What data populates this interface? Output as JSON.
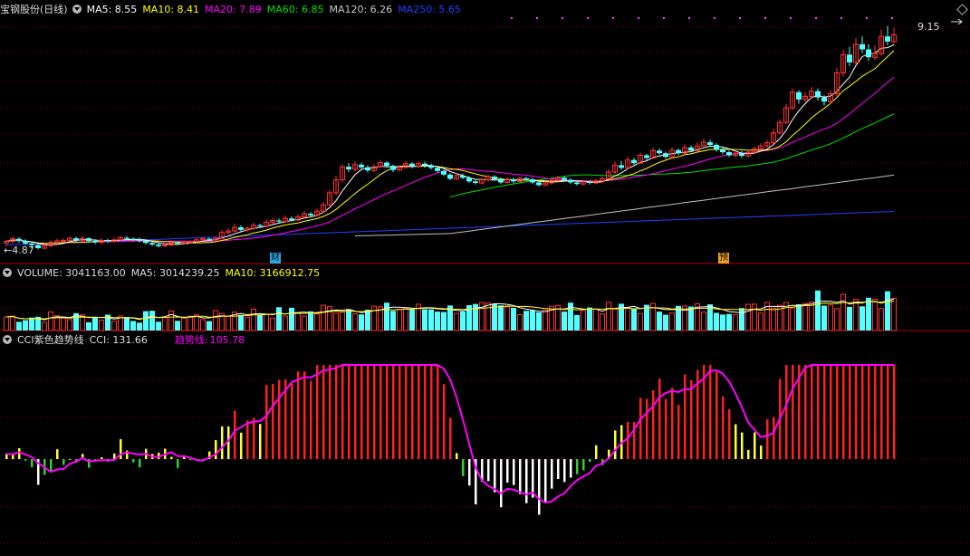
{
  "price_header": {
    "title": "宝钢股份(日线)",
    "ma5": "MA5: 8.55",
    "ma10": "MA10: 8.41",
    "ma20": "MA20: 7.89",
    "ma60": "MA60: 6.85",
    "ma120": "MA120: 6.26",
    "ma250": "MA250: 5.65"
  },
  "price_labels": {
    "high": "9.15",
    "low": "4.87"
  },
  "event_tags": [
    "财",
    "预"
  ],
  "volume_header": {
    "title": "VOLUME: 3041163.00",
    "ma5": "MA5: 3014239.25",
    "ma10": "MA10: 3166912.75"
  },
  "cci_header": {
    "title": "CCI紫色趋势线",
    "cci": "CCI: 131.66",
    "trend_label": "趋势线:",
    "trend_value": "105.78"
  },
  "colors": {
    "up": "#ff3232",
    "down": "#54ffff",
    "ma5": "#ffffff",
    "ma10": "#ffff00",
    "ma20": "#ff00ff",
    "ma60": "#00e000",
    "ma120": "#c0c0c0",
    "ma250": "#2040ff",
    "cci_trend": "#ff00ff",
    "grid": "#7a0000"
  },
  "chart_data": {
    "type": "candlestick",
    "candles": [
      [
        4.99,
        5.02,
        5.05,
        4.92
      ],
      [
        5.02,
        5.07,
        5.12,
        4.98
      ],
      [
        5.07,
        5.03,
        5.1,
        4.99
      ],
      [
        5.03,
        4.98,
        5.06,
        4.95
      ],
      [
        4.98,
        4.95,
        5.01,
        4.89
      ],
      [
        4.95,
        4.89,
        4.97,
        4.87
      ],
      [
        4.89,
        4.94,
        4.98,
        4.87
      ],
      [
        4.94,
        5.0,
        5.04,
        4.91
      ],
      [
        5.0,
        5.03,
        5.07,
        4.97
      ],
      [
        5.03,
        5.04,
        5.08,
        5.0
      ],
      [
        5.04,
        5.08,
        5.12,
        5.01
      ],
      [
        5.08,
        5.04,
        5.11,
        5.01
      ],
      [
        5.04,
        5.08,
        5.12,
        5.01
      ],
      [
        5.08,
        5.03,
        5.1,
        5.0
      ],
      [
        5.03,
        5.0,
        5.06,
        4.97
      ],
      [
        5.0,
        5.04,
        5.08,
        4.98
      ],
      [
        5.04,
        5.02,
        5.07,
        4.99
      ],
      [
        5.02,
        5.05,
        5.09,
        5.0
      ],
      [
        5.05,
        5.09,
        5.13,
        5.03
      ],
      [
        5.09,
        5.07,
        5.12,
        5.04
      ],
      [
        5.07,
        5.06,
        5.1,
        5.03
      ],
      [
        5.06,
        5.03,
        5.09,
        5.0
      ],
      [
        5.03,
        4.99,
        5.05,
        4.96
      ],
      [
        4.99,
        4.96,
        5.02,
        4.93
      ],
      [
        4.96,
        4.93,
        4.99,
        4.9
      ],
      [
        4.93,
        4.95,
        4.98,
        4.91
      ],
      [
        4.95,
        4.99,
        5.02,
        4.93
      ],
      [
        4.99,
        4.98,
        5.02,
        4.95
      ],
      [
        4.98,
        5.0,
        5.04,
        4.96
      ],
      [
        5.0,
        5.02,
        5.05,
        4.98
      ],
      [
        5.02,
        5.05,
        5.08,
        5.0
      ],
      [
        5.05,
        5.07,
        5.1,
        5.03
      ],
      [
        5.07,
        5.05,
        5.09,
        5.03
      ],
      [
        5.05,
        5.08,
        5.11,
        5.03
      ],
      [
        5.08,
        5.19,
        5.24,
        5.06
      ],
      [
        5.19,
        5.22,
        5.28,
        5.15
      ],
      [
        5.22,
        5.29,
        5.36,
        5.19
      ],
      [
        5.29,
        5.24,
        5.33,
        5.21
      ],
      [
        5.24,
        5.27,
        5.31,
        5.2
      ],
      [
        5.27,
        5.33,
        5.38,
        5.24
      ],
      [
        5.33,
        5.31,
        5.36,
        5.28
      ],
      [
        5.31,
        5.39,
        5.44,
        5.29
      ],
      [
        5.39,
        5.42,
        5.47,
        5.36
      ],
      [
        5.42,
        5.4,
        5.46,
        5.37
      ],
      [
        5.4,
        5.46,
        5.52,
        5.38
      ],
      [
        5.46,
        5.43,
        5.5,
        5.4
      ],
      [
        5.43,
        5.49,
        5.54,
        5.41
      ],
      [
        5.49,
        5.55,
        5.6,
        5.46
      ],
      [
        5.55,
        5.52,
        5.58,
        5.48
      ],
      [
        5.52,
        5.6,
        5.65,
        5.5
      ],
      [
        5.6,
        5.72,
        5.78,
        5.57
      ],
      [
        5.72,
        5.95,
        6.0,
        5.7
      ],
      [
        5.95,
        6.2,
        6.28,
        5.9
      ],
      [
        6.2,
        6.45,
        6.5,
        6.15
      ],
      [
        6.45,
        6.4,
        6.52,
        6.35
      ],
      [
        6.4,
        6.49,
        6.55,
        6.36
      ],
      [
        6.49,
        6.44,
        6.53,
        6.4
      ],
      [
        6.44,
        6.38,
        6.48,
        6.34
      ],
      [
        6.38,
        6.45,
        6.5,
        6.35
      ],
      [
        6.45,
        6.53,
        6.58,
        6.42
      ],
      [
        6.53,
        6.47,
        6.56,
        6.43
      ],
      [
        6.47,
        6.39,
        6.49,
        6.35
      ],
      [
        6.39,
        6.44,
        6.48,
        6.36
      ],
      [
        6.44,
        6.51,
        6.56,
        6.41
      ],
      [
        6.51,
        6.46,
        6.54,
        6.42
      ],
      [
        6.46,
        6.51,
        6.55,
        6.43
      ],
      [
        6.51,
        6.48,
        6.55,
        6.43
      ],
      [
        6.48,
        6.43,
        6.51,
        6.4
      ],
      [
        6.43,
        6.37,
        6.46,
        6.34
      ],
      [
        6.37,
        6.3,
        6.4,
        6.27
      ],
      [
        6.3,
        6.22,
        6.33,
        6.19
      ],
      [
        6.22,
        6.28,
        6.33,
        6.2
      ],
      [
        6.28,
        6.24,
        6.32,
        6.21
      ],
      [
        6.24,
        6.17,
        6.27,
        6.14
      ],
      [
        6.17,
        6.14,
        6.2,
        6.11
      ],
      [
        6.14,
        6.2,
        6.24,
        6.11
      ],
      [
        6.2,
        6.26,
        6.3,
        6.16
      ],
      [
        6.26,
        6.21,
        6.29,
        6.18
      ],
      [
        6.21,
        6.15,
        6.24,
        6.12
      ],
      [
        6.15,
        6.21,
        6.25,
        6.13
      ],
      [
        6.21,
        6.17,
        6.24,
        6.13
      ],
      [
        6.17,
        6.23,
        6.27,
        6.15
      ],
      [
        6.23,
        6.21,
        6.26,
        6.18
      ],
      [
        6.21,
        6.15,
        6.24,
        6.12
      ],
      [
        6.15,
        6.1,
        6.17,
        6.07
      ],
      [
        6.1,
        6.14,
        6.18,
        6.08
      ],
      [
        6.14,
        6.19,
        6.23,
        6.11
      ],
      [
        6.19,
        6.24,
        6.28,
        6.17
      ],
      [
        6.24,
        6.2,
        6.27,
        6.16
      ],
      [
        6.2,
        6.15,
        6.23,
        6.12
      ],
      [
        6.15,
        6.12,
        6.18,
        6.09
      ],
      [
        6.12,
        6.16,
        6.2,
        6.1
      ],
      [
        6.16,
        6.14,
        6.19,
        6.11
      ],
      [
        6.14,
        6.18,
        6.22,
        6.12
      ],
      [
        6.18,
        6.22,
        6.26,
        6.15
      ],
      [
        6.22,
        6.35,
        6.41,
        6.2
      ],
      [
        6.35,
        6.48,
        6.55,
        6.31
      ],
      [
        6.48,
        6.43,
        6.56,
        6.39
      ],
      [
        6.43,
        6.58,
        6.65,
        6.4
      ],
      [
        6.58,
        6.52,
        6.62,
        6.49
      ],
      [
        6.52,
        6.67,
        6.72,
        6.5
      ],
      [
        6.67,
        6.62,
        6.7,
        6.58
      ],
      [
        6.62,
        6.76,
        6.82,
        6.59
      ],
      [
        6.76,
        6.71,
        6.8,
        6.68
      ],
      [
        6.71,
        6.64,
        6.74,
        6.6
      ],
      [
        6.64,
        6.77,
        6.82,
        6.61
      ],
      [
        6.77,
        6.71,
        6.8,
        6.67
      ],
      [
        6.71,
        6.82,
        6.88,
        6.68
      ],
      [
        6.82,
        6.76,
        6.86,
        6.73
      ],
      [
        6.76,
        6.85,
        6.92,
        6.73
      ],
      [
        6.85,
        6.92,
        6.99,
        6.82
      ],
      [
        6.92,
        6.87,
        6.97,
        6.83
      ],
      [
        6.87,
        6.78,
        6.9,
        6.74
      ],
      [
        6.78,
        6.73,
        6.82,
        6.69
      ],
      [
        6.73,
        6.67,
        6.76,
        6.64
      ],
      [
        6.67,
        6.71,
        6.75,
        6.63
      ],
      [
        6.71,
        6.66,
        6.76,
        6.62
      ],
      [
        6.66,
        6.73,
        6.77,
        6.63
      ],
      [
        6.73,
        6.79,
        6.84,
        6.7
      ],
      [
        6.79,
        6.85,
        6.9,
        6.76
      ],
      [
        6.85,
        6.91,
        6.96,
        6.82
      ],
      [
        6.91,
        7.1,
        7.18,
        6.88
      ],
      [
        7.1,
        7.3,
        7.36,
        7.06
      ],
      [
        7.3,
        7.58,
        7.66,
        7.27
      ],
      [
        7.58,
        7.88,
        7.95,
        7.54
      ],
      [
        7.88,
        7.74,
        7.92,
        7.66
      ],
      [
        7.74,
        7.8,
        7.88,
        7.7
      ],
      [
        7.8,
        7.9,
        7.98,
        7.76
      ],
      [
        7.9,
        7.78,
        7.95,
        7.72
      ],
      [
        7.78,
        7.7,
        7.82,
        7.62
      ],
      [
        7.7,
        7.85,
        7.92,
        7.66
      ],
      [
        7.85,
        8.25,
        8.35,
        7.8
      ],
      [
        8.25,
        8.6,
        8.7,
        8.18
      ],
      [
        8.6,
        8.45,
        8.75,
        8.38
      ],
      [
        8.45,
        8.8,
        8.92,
        8.4
      ],
      [
        8.8,
        8.7,
        8.95,
        8.63
      ],
      [
        8.7,
        8.55,
        8.8,
        8.48
      ],
      [
        8.55,
        8.62,
        8.78,
        8.5
      ],
      [
        8.62,
        8.95,
        9.08,
        8.58
      ],
      [
        8.95,
        8.85,
        9.15,
        8.78
      ],
      [
        8.85,
        8.98,
        9.12,
        8.8
      ]
    ],
    "volume_bars": 152,
    "cci_count": 152
  }
}
